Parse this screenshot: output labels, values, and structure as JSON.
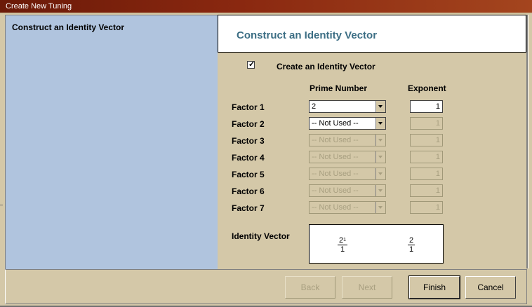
{
  "window": {
    "title": "Create New Tuning"
  },
  "sidebar": {
    "steps": [
      {
        "label": "Construct an Identity Vector"
      }
    ]
  },
  "header": {
    "title": "Construct an Identity Vector"
  },
  "form": {
    "checkbox_label": "Create an Identity Vector",
    "checkbox_checked": true,
    "checkbox_mark": "✓",
    "columns": {
      "prime": "Prime Number",
      "exponent": "Exponent"
    },
    "factors": [
      {
        "label": "Factor 1",
        "prime": "2",
        "exponent": "1",
        "enabled": true
      },
      {
        "label": "Factor 2",
        "prime": "-- Not Used --",
        "exponent": "1",
        "enabled": true
      },
      {
        "label": "Factor 3",
        "prime": "-- Not Used --",
        "exponent": "1",
        "enabled": false
      },
      {
        "label": "Factor 4",
        "prime": "-- Not Used --",
        "exponent": "1",
        "enabled": false
      },
      {
        "label": "Factor 5",
        "prime": "-- Not Used --",
        "exponent": "1",
        "enabled": false
      },
      {
        "label": "Factor 6",
        "prime": "-- Not Used --",
        "exponent": "1",
        "enabled": false
      },
      {
        "label": "Factor 7",
        "prime": "-- Not Used --",
        "exponent": "1",
        "enabled": false
      }
    ],
    "identity_vector_label": "Identity Vector",
    "identity_vector": {
      "power": {
        "base": "2",
        "exp": "1",
        "den": "1"
      },
      "ratio": {
        "num": "2",
        "den": "1"
      }
    }
  },
  "buttons": {
    "back": "Back",
    "next": "Next",
    "finish": "Finish",
    "cancel": "Cancel"
  },
  "colors": {
    "dialog_bg": "#d4c8a8",
    "sidebar_bg": "#b0c4de",
    "header_text": "#3c6e84",
    "titlebar": "#8a2810"
  }
}
